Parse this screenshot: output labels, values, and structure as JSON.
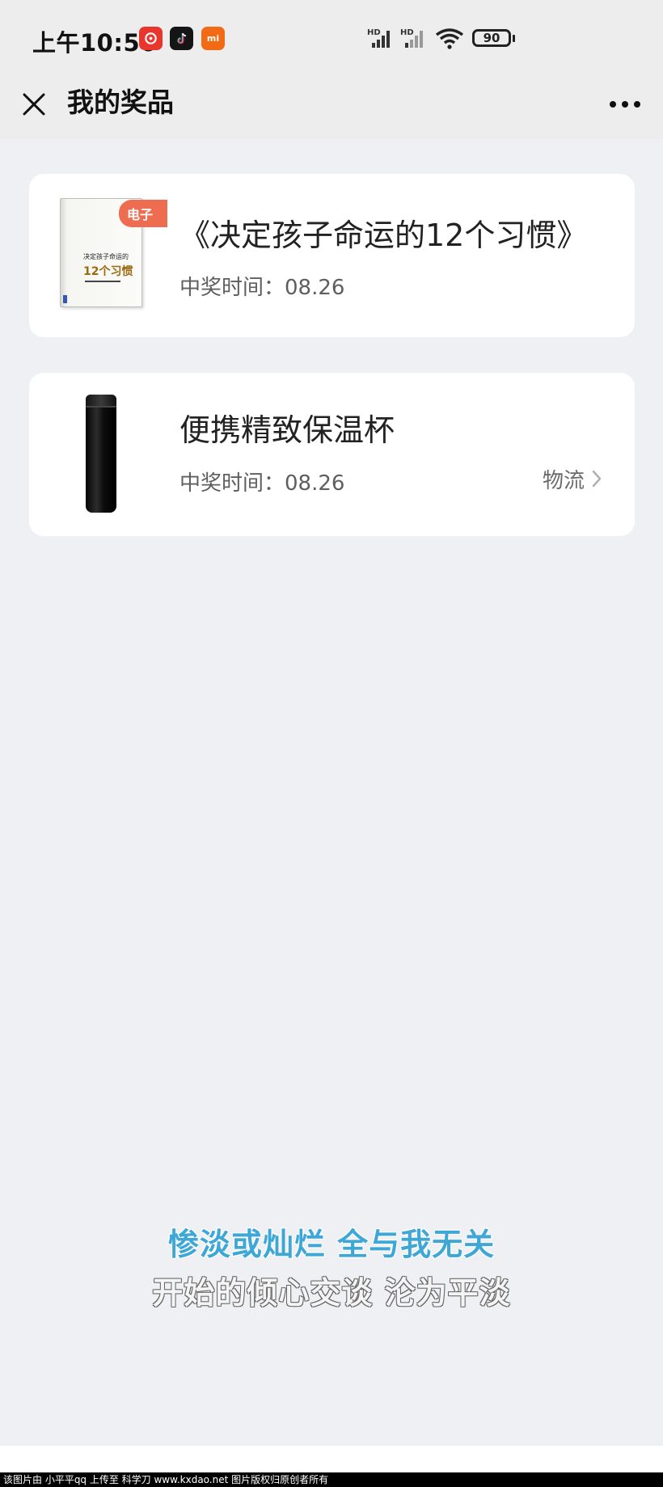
{
  "status_bar": {
    "time": "上午10:56",
    "battery": "90",
    "signal_1": "HD",
    "signal_2": "HD",
    "app_icons": [
      "netease-music-icon",
      "tiktok-icon",
      "mi-icon"
    ],
    "mi_label": "mi"
  },
  "nav": {
    "title": "我的奖品",
    "close_icon": "close-icon",
    "more_icon": "more-icon"
  },
  "prizes": [
    {
      "name": "《决定孩子命运的12个习惯》",
      "time": "中奖时间：08.26",
      "badge": "电子",
      "cover_title": "决定孩子命运的",
      "cover_subtitle": "12个习惯"
    },
    {
      "name": "便携精致保温杯",
      "time": "中奖时间：08.26",
      "action_label": "物流"
    }
  ],
  "lyrics": {
    "line_1": "惨淡或灿烂 全与我无关",
    "line_2": "开始的倾心交谈 沦为平淡"
  },
  "watermark": "该图片由 小平平qq 上传至 科学刀 www.kxdao.net 图片版权归原创者所有",
  "colors": {
    "background": "#EFF0F4",
    "nav_bg": "#EDEDED",
    "card_bg": "#FFFFFF",
    "badge": "#EE6C50",
    "lyric_accent": "#3FA7D6"
  }
}
